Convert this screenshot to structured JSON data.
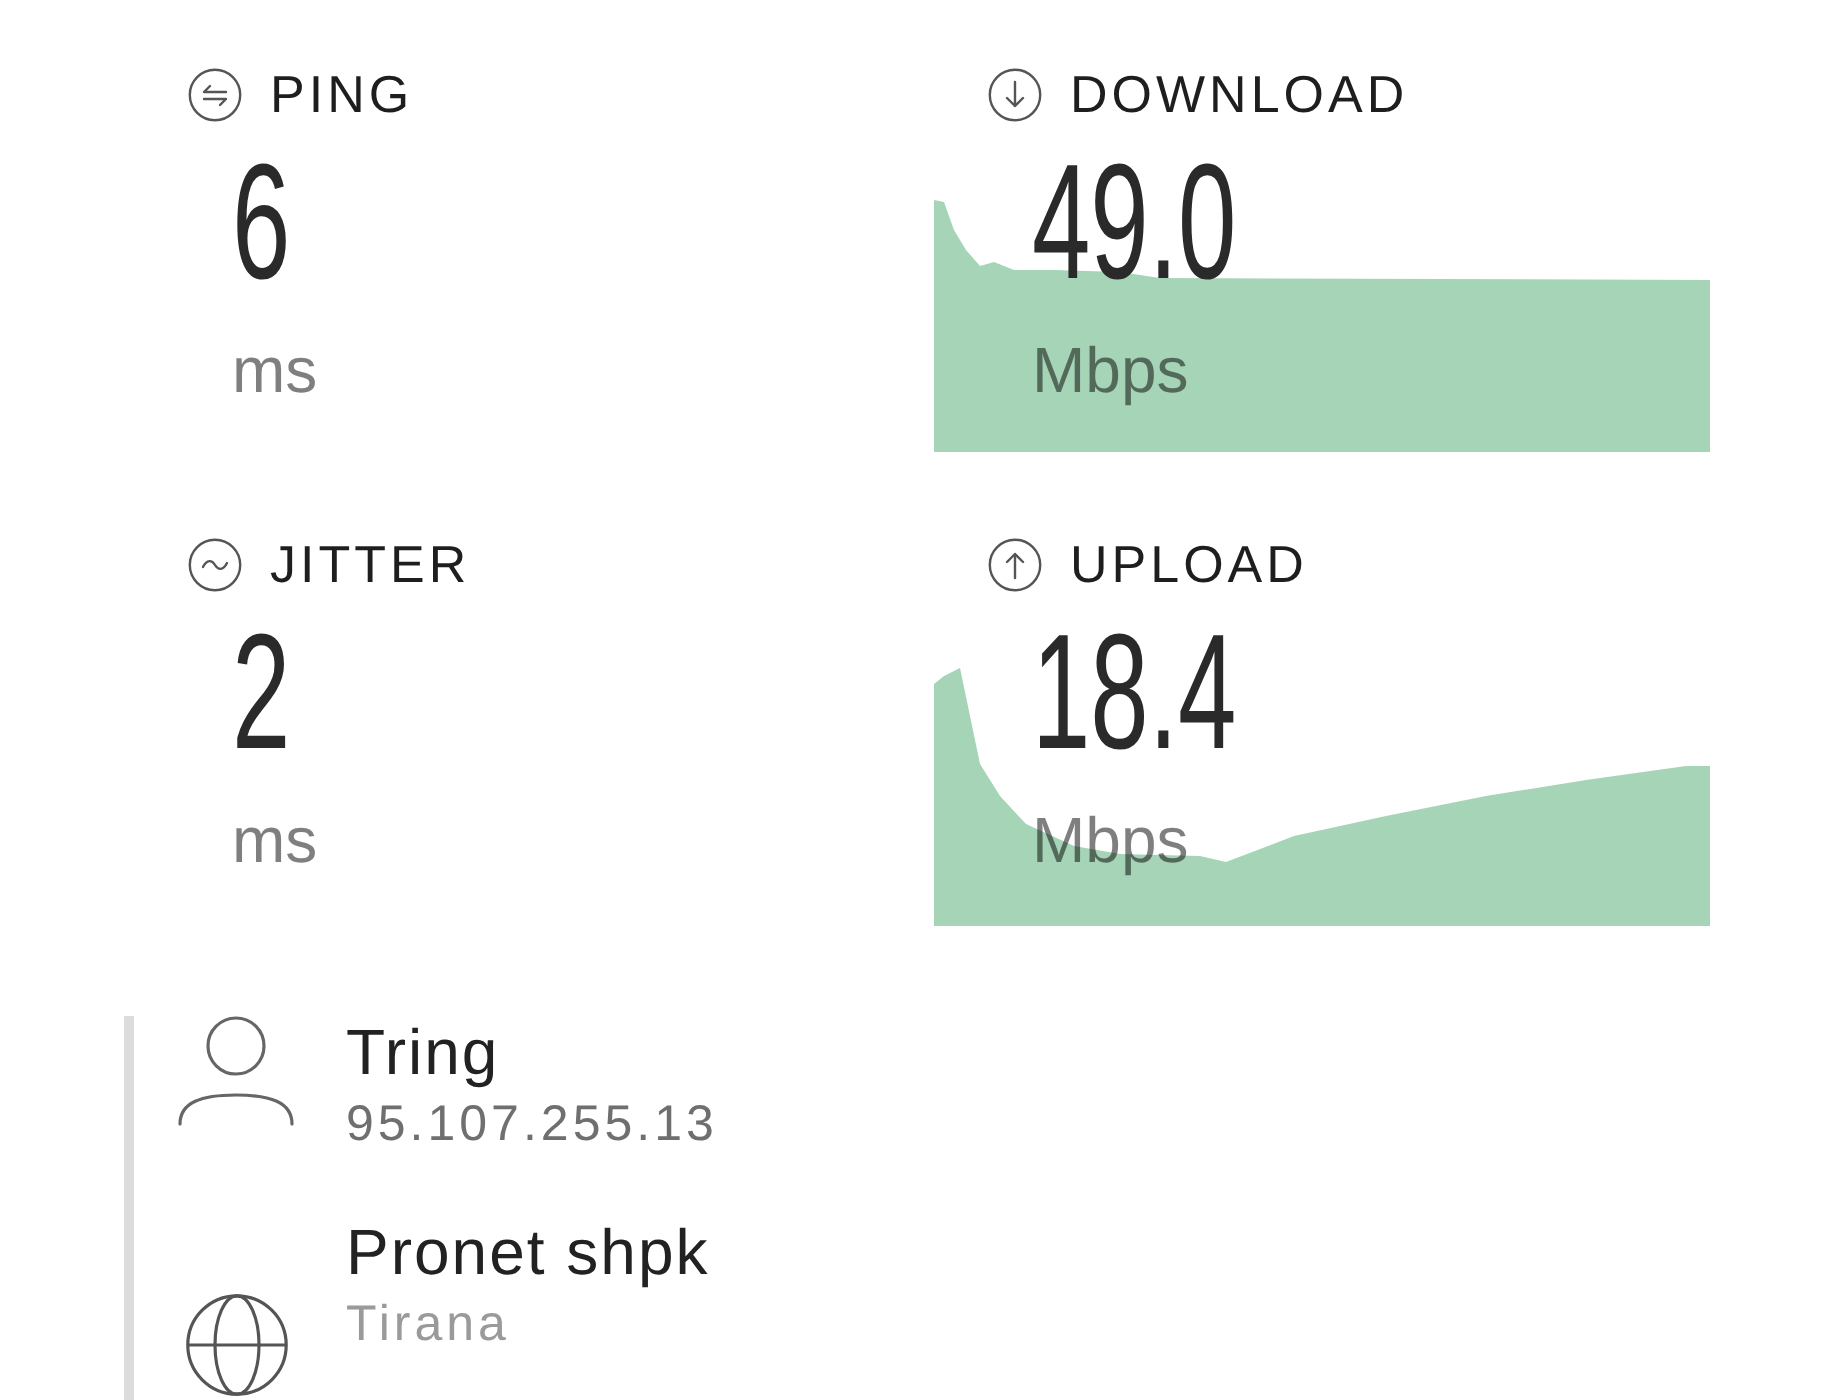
{
  "metrics": [
    {
      "kind": "ping",
      "label": "PING",
      "value": "6",
      "unit": "ms"
    },
    {
      "kind": "download",
      "label": "DOWNLOAD",
      "value": "49.0",
      "unit": "Mbps"
    },
    {
      "kind": "jitter",
      "label": "JITTER",
      "value": "2",
      "unit": "ms"
    },
    {
      "kind": "upload",
      "label": "UPLOAD",
      "value": "18.4",
      "unit": "Mbps"
    }
  ],
  "connection": [
    {
      "kind": "client",
      "name": "Tring",
      "detail": "95.107.255.13"
    },
    {
      "kind": "server",
      "name": "Pronet shpk",
      "detail": "Tirana"
    }
  ]
}
